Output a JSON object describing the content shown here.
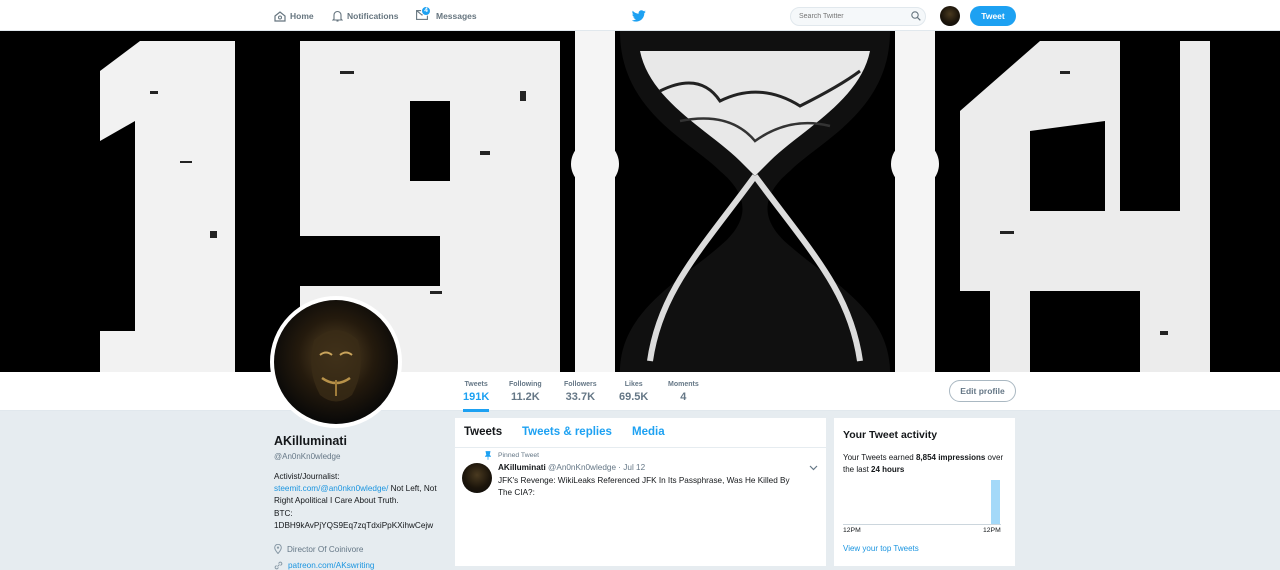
{
  "nav": {
    "home": "Home",
    "notifications": "Notifications",
    "messages": "Messages",
    "messages_badge": "4",
    "search_placeholder": "Search Twitter",
    "tweet_button": "Tweet",
    "brand_color": "#1da1f2"
  },
  "profile": {
    "name": "AKilluminati",
    "handle": "@An0nKn0wledge",
    "bio_line1": "Activist/Journalist:",
    "bio_link": "steemit.com/@an0nkn0wledge/",
    "bio_line2": " Not Left, Not Right Apolitical I Care About Truth.",
    "bio_line3": "BTC:",
    "bio_line4": "1DBH9kAvPjYQS9Eq7zqTdxiPpKXihwCejw",
    "location": "Director Of Coinivore",
    "website": "patreon.com/AKswriting",
    "edit_profile": "Edit profile"
  },
  "stats": [
    {
      "label": "Tweets",
      "value": "191K"
    },
    {
      "label": "Following",
      "value": "11.2K"
    },
    {
      "label": "Followers",
      "value": "33.7K"
    },
    {
      "label": "Likes",
      "value": "69.5K"
    },
    {
      "label": "Moments",
      "value": "4"
    }
  ],
  "timeline": {
    "tabs": [
      "Tweets",
      "Tweets & replies",
      "Media"
    ],
    "pinned_label": "Pinned Tweet",
    "tweet": {
      "name": "AKilluminati",
      "handle": "@An0nKn0wledge",
      "date": "Jul 12",
      "text": "JFK's Revenge: WikiLeaks Referenced JFK In Its Passphrase, Was He Killed By The CIA?:"
    }
  },
  "activity": {
    "title": "Your Tweet activity",
    "text_pre": "Your Tweets earned ",
    "impressions": "8,854 impressions",
    "text_mid": " over the last ",
    "period": "24 hours",
    "tick_left": "12PM",
    "tick_right": "12PM",
    "link": "View your top Tweets"
  }
}
